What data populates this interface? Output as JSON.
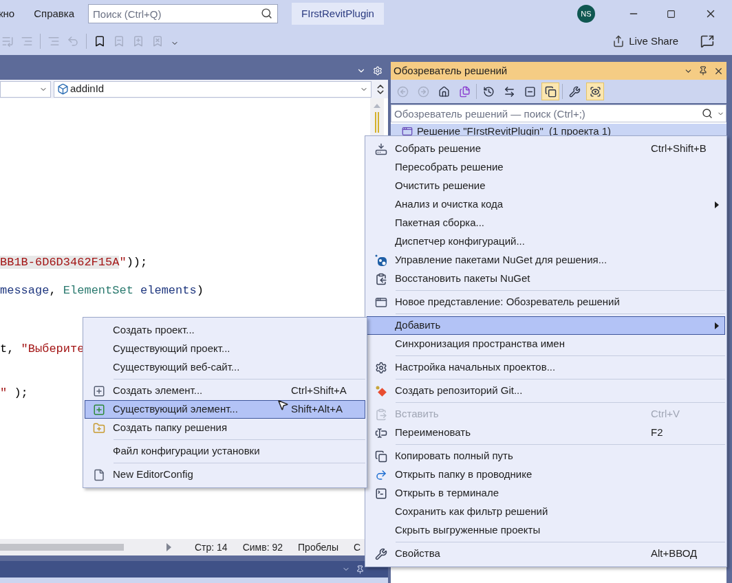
{
  "menu_bar": {
    "items": [
      "кно",
      "Справка"
    ]
  },
  "search": {
    "placeholder": "Поиск (Ctrl+Q)"
  },
  "solution_badge": "FIrstRevitPlugin",
  "account": {
    "initials": "NS"
  },
  "live_share": "Live Share",
  "editor": {
    "nav_bar": {
      "member": "addinId"
    },
    "code_lines": [
      {
        "tokens": [
          {
            "text": "BB1B-6D6D3462F15A",
            "kind": "string",
            "highlighted": true
          },
          {
            "text": "\"",
            "kind": "string",
            "highlighted": false
          },
          {
            "text": "));",
            "kind": "plain",
            "highlighted": false
          }
        ]
      },
      {
        "tokens": [
          {
            "text": "message",
            "kind": "param",
            "highlighted": false
          },
          {
            "text": ", ",
            "kind": "plain",
            "highlighted": false
          },
          {
            "text": "ElementSet",
            "kind": "type",
            "highlighted": false
          },
          {
            "text": " elements",
            "kind": "param",
            "highlighted": false
          },
          {
            "text": ")",
            "kind": "plain",
            "highlighted": false
          }
        ]
      },
      {
        "tokens": [
          {
            "text": "t, ",
            "kind": "plain",
            "highlighted": false
          },
          {
            "text": "\"Выберите",
            "kind": "string",
            "highlighted": false
          }
        ]
      },
      {
        "tokens": [
          {
            "text": "\"",
            "kind": "string",
            "highlighted": false
          },
          {
            "text": " );",
            "kind": "plain",
            "highlighted": false
          }
        ]
      }
    ],
    "status": [
      "Стр: 14",
      "Симв: 92",
      "Пробелы",
      "C"
    ]
  },
  "solution_explorer": {
    "title": "Обозреватель решений",
    "toolbar": [
      {
        "disabled": true,
        "on": false
      },
      {
        "disabled": true,
        "on": false
      },
      {
        "disabled": false,
        "on": false
      },
      {
        "disabled": false,
        "on": false
      },
      {
        "disabled": false,
        "on": false
      },
      {
        "disabled": false,
        "on": false
      },
      {
        "disabled": false,
        "on": false
      },
      {
        "disabled": false,
        "on": true
      },
      {
        "disabled": false,
        "on": false
      },
      {
        "disabled": false,
        "on": true
      }
    ],
    "search": {
      "placeholder": "Обозреватель решений — поиск (Ctrl+;)"
    },
    "tree": [
      {
        "label": "Решение \"FIrstRevitPlugin\"  (1 проекта 1)",
        "selected": true
      }
    ]
  },
  "context_menu": {
    "items": [
      {
        "kind": "command",
        "label": "Собрать решение",
        "shortcut": "Ctrl+Shift+B",
        "submenu": false,
        "disabled": false,
        "selected": false
      },
      {
        "kind": "command",
        "label": "Пересобрать решение",
        "submenu": false,
        "disabled": false,
        "selected": false
      },
      {
        "kind": "command",
        "label": "Очистить решение",
        "submenu": false,
        "disabled": false,
        "selected": false
      },
      {
        "kind": "command",
        "label": "Анализ и очистка кода",
        "submenu": true,
        "disabled": false,
        "selected": false
      },
      {
        "kind": "command",
        "label": "Пакетная сборка...",
        "submenu": false,
        "disabled": false,
        "selected": false
      },
      {
        "kind": "command",
        "label": "Диспетчер конфигураций...",
        "submenu": false,
        "disabled": false,
        "selected": false
      },
      {
        "kind": "command",
        "label": "Управление пакетами NuGet для решения...",
        "submenu": false,
        "disabled": false,
        "selected": false
      },
      {
        "kind": "command",
        "label": "Восстановить пакеты NuGet",
        "submenu": false,
        "disabled": false,
        "selected": false
      },
      {
        "kind": "separator"
      },
      {
        "kind": "command",
        "label": "Новое представление: Обозреватель решений",
        "submenu": false,
        "disabled": false,
        "selected": false
      },
      {
        "kind": "separator"
      },
      {
        "kind": "command",
        "label": "Добавить",
        "submenu": true,
        "disabled": false,
        "selected": true
      },
      {
        "kind": "command",
        "label": "Синхронизация пространства имен",
        "submenu": false,
        "disabled": false,
        "selected": false
      },
      {
        "kind": "separator"
      },
      {
        "kind": "command",
        "label": "Настройка начальных проектов...",
        "submenu": false,
        "disabled": false,
        "selected": false
      },
      {
        "kind": "separator"
      },
      {
        "kind": "command",
        "label": "Создать репозиторий Git...",
        "submenu": false,
        "disabled": false,
        "selected": false
      },
      {
        "kind": "separator"
      },
      {
        "kind": "command",
        "label": "Вставить",
        "shortcut": "Ctrl+V",
        "submenu": false,
        "disabled": true,
        "selected": false
      },
      {
        "kind": "command",
        "label": "Переименовать",
        "shortcut": "F2",
        "submenu": false,
        "disabled": false,
        "selected": false
      },
      {
        "kind": "separator"
      },
      {
        "kind": "command",
        "label": "Копировать полный путь",
        "submenu": false,
        "disabled": false,
        "selected": false
      },
      {
        "kind": "command",
        "label": "Открыть папку в проводнике",
        "submenu": false,
        "disabled": false,
        "selected": false
      },
      {
        "kind": "command",
        "label": "Открыть в терминале",
        "submenu": false,
        "disabled": false,
        "selected": false
      },
      {
        "kind": "command",
        "label": "Сохранить как фильтр решений",
        "submenu": false,
        "disabled": false,
        "selected": false
      },
      {
        "kind": "command",
        "label": "Скрыть выгруженные проекты",
        "submenu": false,
        "disabled": false,
        "selected": false
      },
      {
        "kind": "separator"
      },
      {
        "kind": "command",
        "label": "Свойства",
        "shortcut": "Alt+ВВОД",
        "submenu": false,
        "disabled": false,
        "selected": false
      }
    ]
  },
  "submenu": {
    "items": [
      {
        "kind": "command",
        "label": "Создать проект...",
        "selected": false
      },
      {
        "kind": "command",
        "label": "Существующий проект...",
        "selected": false
      },
      {
        "kind": "command",
        "label": "Существующий веб-сайт...",
        "selected": false
      },
      {
        "kind": "separator"
      },
      {
        "kind": "command",
        "label": "Создать элемент...",
        "shortcut": "Ctrl+Shift+A",
        "selected": false
      },
      {
        "kind": "command",
        "label": "Существующий элемент...",
        "shortcut": "Shift+Alt+A",
        "selected": true
      },
      {
        "kind": "command",
        "label": "Создать папку решения",
        "selected": false
      },
      {
        "kind": "separator"
      },
      {
        "kind": "command",
        "label": "Файл конфигурации установки",
        "selected": false
      },
      {
        "kind": "separator"
      },
      {
        "kind": "command",
        "label": "New EditorConfig",
        "selected": false
      }
    ]
  }
}
